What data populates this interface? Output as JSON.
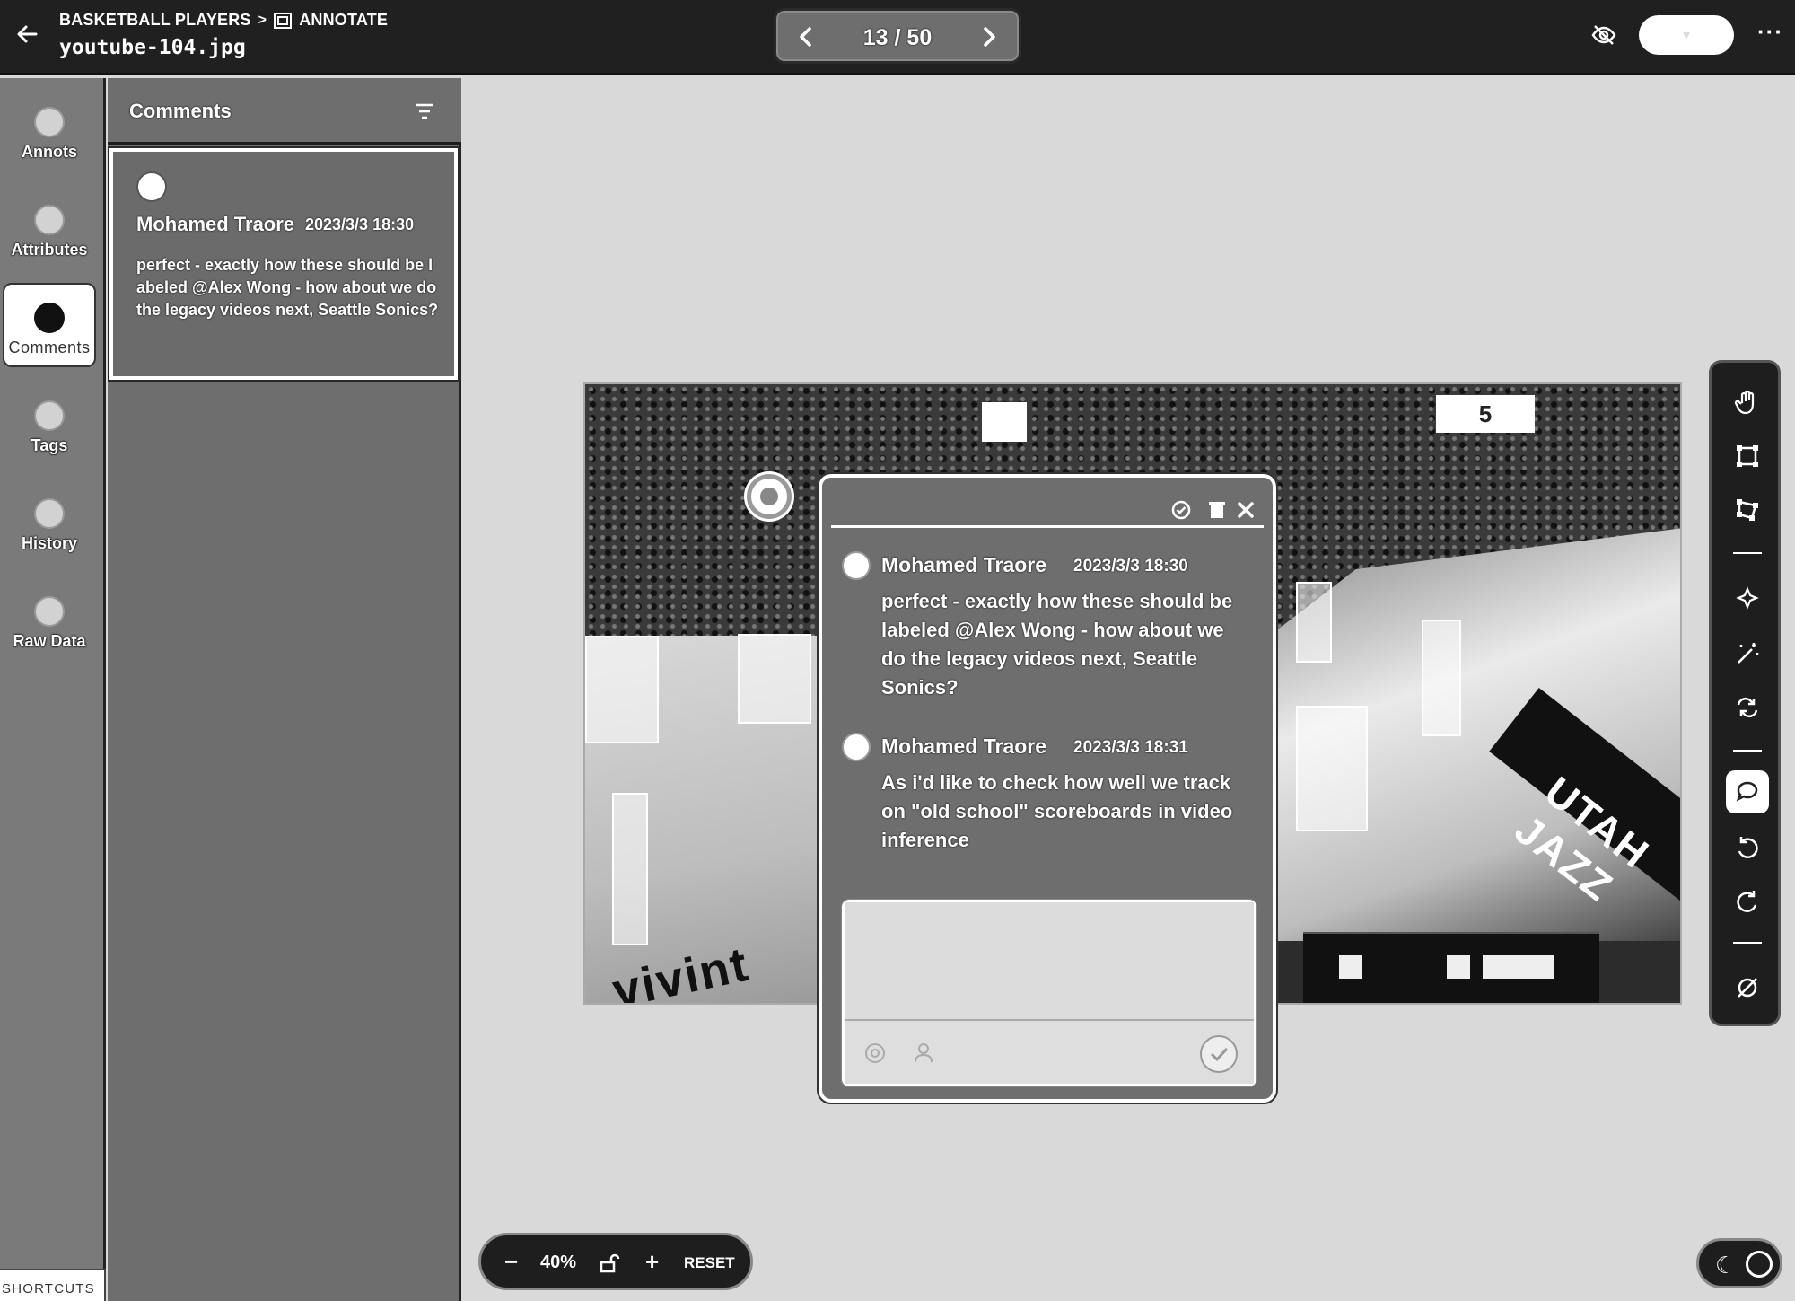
{
  "header": {
    "breadcrumb_project": "BASKETBALL PLAYERS",
    "breadcrumb_separator": ">",
    "breadcrumb_section": "ANNOTATE",
    "filename": "youtube-104.jpg",
    "pager": "13 / 50",
    "icons": [
      "back-arrow-icon",
      "annotate-icon",
      "chevron-left-icon",
      "chevron-right-icon",
      "eye-off-icon",
      "more-icon"
    ]
  },
  "leftnav": {
    "items": [
      {
        "label": "Annots",
        "icon": "annotations-icon"
      },
      {
        "label": "Attributes",
        "icon": "attributes-icon"
      },
      {
        "label": "Comments",
        "icon": "comments-icon",
        "active": true
      },
      {
        "label": "Tags",
        "icon": "tags-icon"
      },
      {
        "label": "History",
        "icon": "history-icon"
      },
      {
        "label": "Raw Data",
        "icon": "raw-data-icon"
      }
    ],
    "shortcuts": "SHORTCUTS"
  },
  "comments_panel": {
    "title": "Comments",
    "cards": [
      {
        "author": "Mohamed Traore",
        "date": "2023/3/3 18:30",
        "text": "perfect - exactly how these should be labeled @Alex Wong - how about we do the legacy videos next, Seattle Sonics?"
      }
    ]
  },
  "canvas": {
    "banner_top": "5",
    "vivint": "vivint",
    "court_text": "UTAH JAZZ"
  },
  "thread": {
    "messages": [
      {
        "author": "Mohamed Traore",
        "date": "2023/3/3 18:30",
        "text": "perfect - exactly how these should be labeled @Alex Wong - how about we do the legacy videos next, Seattle Sonics?"
      },
      {
        "author": "Mohamed Traore",
        "date": "2023/3/3 18:31",
        "text": "As i'd like to check how well we track on \"old school\" scoreboards in video inference"
      }
    ],
    "reply_placeholder": ""
  },
  "tools": [
    "hand-icon",
    "bounding-box-icon",
    "polygon-icon",
    "smart-select-icon",
    "magic-wand-icon",
    "repeat-icon",
    "comment-icon",
    "undo-icon",
    "redo-icon",
    "null-icon"
  ],
  "zoom": {
    "minus": "−",
    "value": "40%",
    "plus": "+",
    "reset": "RESET"
  },
  "colors": {
    "header_bg": "#202020",
    "panel_bg": "#6e6e6e",
    "canvas_bg": "#d9d9d9",
    "rail_bg": "#1e1e1e"
  }
}
